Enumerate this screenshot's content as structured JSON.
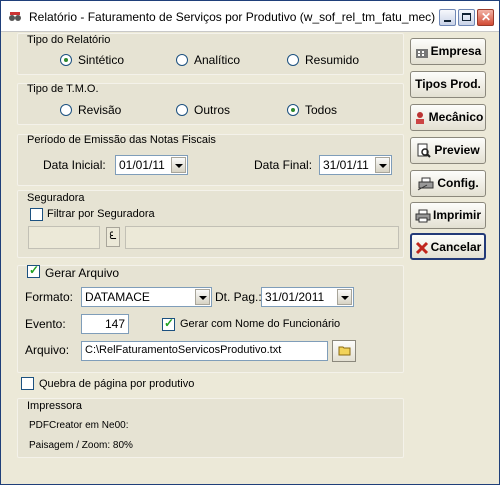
{
  "window": {
    "title": "Relatório - Faturamento de Serviços por Produtivo (w_sof_rel_tm_fatu_mec)"
  },
  "tipo_relatorio": {
    "label": "Tipo do Relatório",
    "options": [
      "Sintético",
      "Analítico",
      "Resumido"
    ],
    "selected": "Sintético"
  },
  "tipo_tmo": {
    "label": "Tipo de T.M.O.",
    "options": [
      "Revisão",
      "Outros",
      "Todos"
    ],
    "selected": "Todos"
  },
  "periodo": {
    "label": "Período de Emissão das Notas Fiscais",
    "data_inicial_label": "Data Inicial:",
    "data_inicial": "01/01/11",
    "data_final_label": "Data Final:",
    "data_final": "31/01/11"
  },
  "seguradora": {
    "label": "Seguradora",
    "filtrar_label": "Filtrar por Seguradora",
    "filtrar_checked": false,
    "code": "",
    "name": ""
  },
  "arquivo": {
    "gerar_label": "Gerar Arquivo",
    "gerar_checked": true,
    "formato_label": "Formato:",
    "formato": "DATAMACE",
    "dt_pag_label": "Dt. Pag.:",
    "dt_pag": "31/01/2011",
    "evento_label": "Evento:",
    "evento": "147",
    "gerar_nome_label": "Gerar com Nome do Funcionário",
    "gerar_nome_checked": true,
    "arquivo_label": "Arquivo:",
    "arquivo_path": "C:\\RelFaturamentoServicosProdutivo.txt"
  },
  "quebra": {
    "label": "Quebra de página por produtivo",
    "checked": false
  },
  "impressora": {
    "label": "Impressora",
    "printer": "PDFCreator em Ne00:",
    "layout": "Paisagem / Zoom: 80%"
  },
  "buttons": {
    "empresa": "Empresa",
    "tipos_prod": "Tipos Prod.",
    "mecanico": "Mecânico",
    "preview": "Preview",
    "config": "Config.",
    "imprimir": "Imprimir",
    "cancelar": "Cancelar"
  },
  "colors": {
    "accent_green": "#2f8a2f",
    "cancel_red": "#c0241b",
    "title_border": "#1f3f7a"
  },
  "icons": [
    "app-icon",
    "building-icon",
    "mechanic-icon",
    "preview-icon",
    "printer-config-icon",
    "printer-icon",
    "cancel-icon",
    "folder-icon",
    "lookup-icon"
  ]
}
